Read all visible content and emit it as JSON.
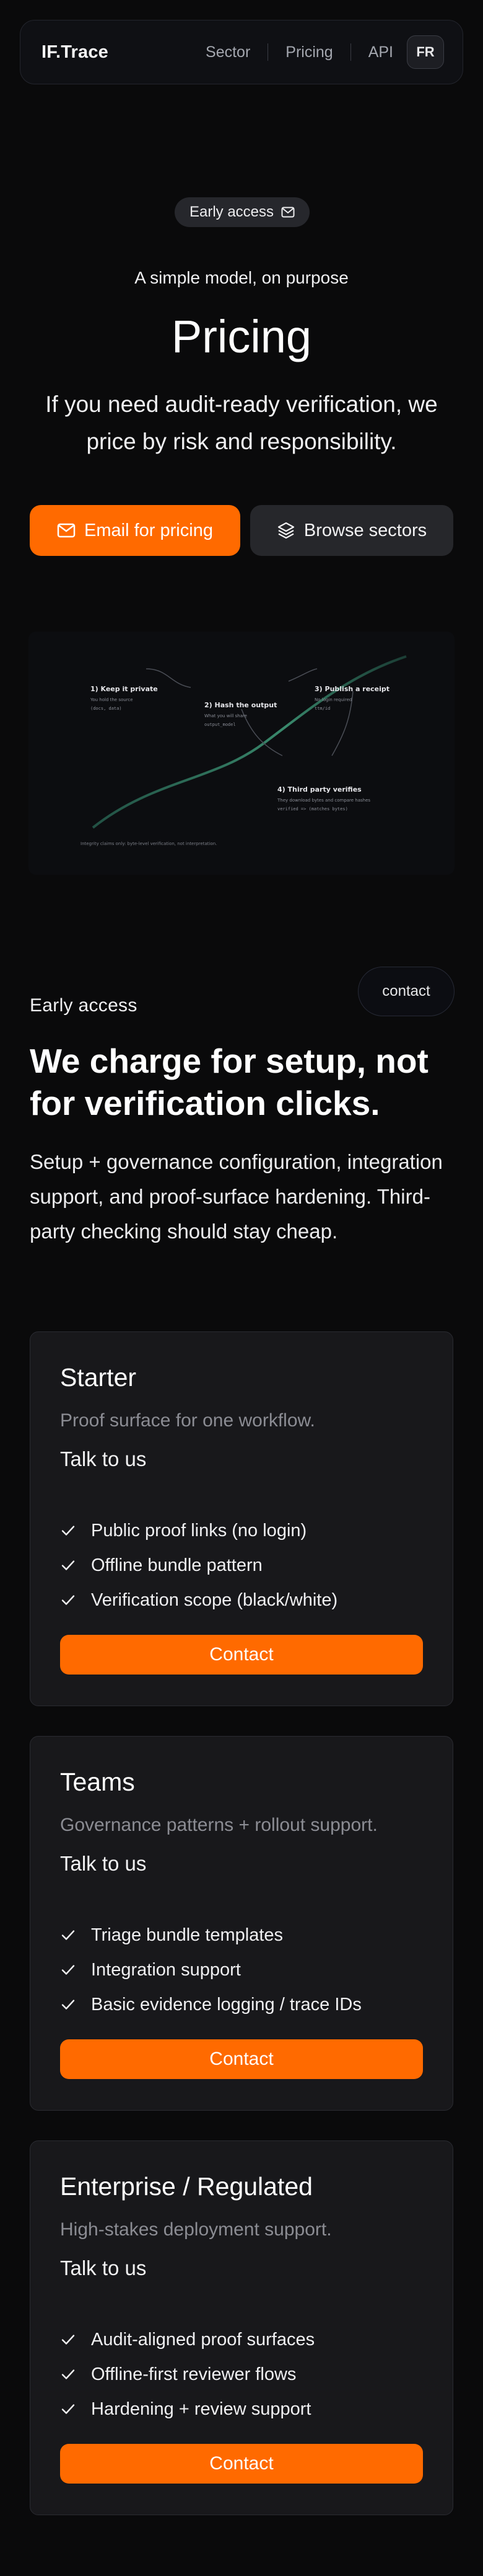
{
  "nav": {
    "brand": "IF.Trace",
    "links": [
      "Sector",
      "Pricing",
      "API"
    ],
    "lang": "FR"
  },
  "hero": {
    "badge": "Early access",
    "badge_icon": "mail-icon",
    "kicker": "A simple model, on purpose",
    "title": "Pricing",
    "lead": "If you need audit-ready verification, we price by risk and responsibility.",
    "primary_cta": "Email for pricing",
    "primary_cta_icon": "mail-icon",
    "secondary_cta": "Browse sectors",
    "secondary_cta_icon": "layers-icon"
  },
  "diagram": {
    "steps": [
      {
        "title": "1) Keep it private",
        "lines": [
          "You hold the source",
          "(docs, data)"
        ]
      },
      {
        "title": "2) Hash the output",
        "lines": [
          "What you will share",
          "output_model"
        ]
      },
      {
        "title": "3) Publish a receipt",
        "lines": [
          "No login required",
          "ttm/id"
        ]
      },
      {
        "title": "4) Third party verifies",
        "lines": [
          "They download bytes and compare hashes",
          "verified => (matches bytes)"
        ]
      }
    ],
    "caption": "Integrity claims only: byte-level verification, not interpretation."
  },
  "pricing": {
    "eyebrow": "Early access",
    "contact_pill": "contact",
    "heading": "We charge for setup, not for verification clicks.",
    "description": "Setup + governance configuration, integration support, and proof-surface hardening. Third-party checking should stay cheap.",
    "plans": [
      {
        "name": "Starter",
        "subtitle": "Proof surface for one workflow.",
        "price": "Talk to us",
        "features": [
          "Public proof links (no login)",
          "Offline bundle pattern",
          "Verification scope (black/white)"
        ],
        "cta": "Contact"
      },
      {
        "name": "Teams",
        "subtitle": "Governance patterns + rollout support.",
        "price": "Talk to us",
        "features": [
          "Triage bundle templates",
          "Integration support",
          "Basic evidence logging / trace IDs"
        ],
        "cta": "Contact"
      },
      {
        "name": "Enterprise / Regulated",
        "subtitle": "High-stakes deployment support.",
        "price": "Talk to us",
        "features": [
          "Audit-aligned proof surfaces",
          "Offline-first reviewer flows",
          "Hardening + review support"
        ],
        "cta": "Contact"
      }
    ]
  },
  "colors": {
    "accent": "#ff6a00",
    "background": "#0a0a0b",
    "card": "#18181b",
    "curve": "#2f7d63"
  }
}
